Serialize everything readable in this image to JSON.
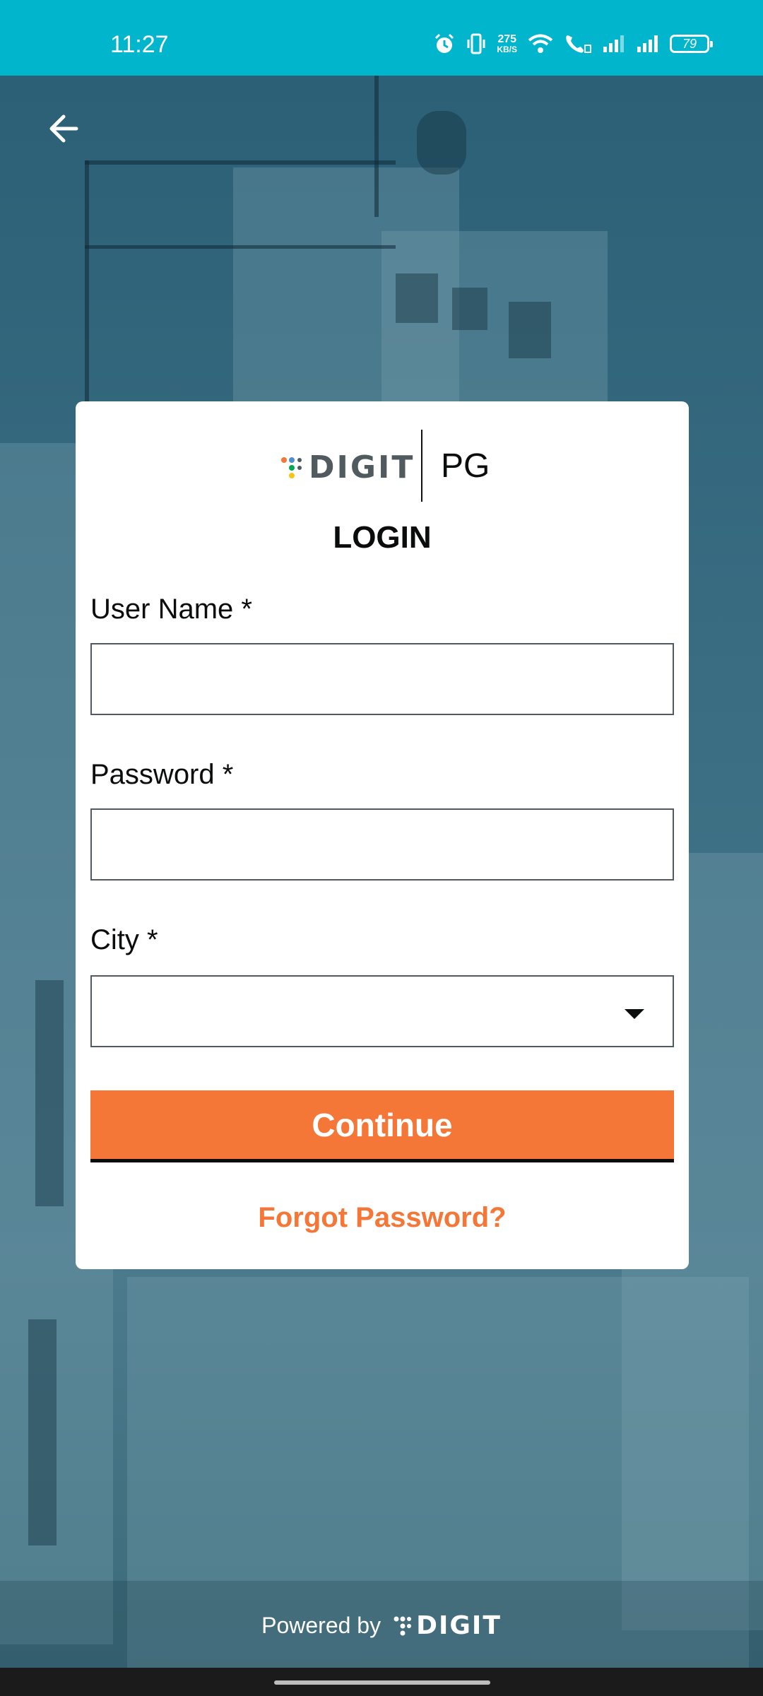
{
  "status_bar": {
    "time": "11:27",
    "net_speed_value": "275",
    "net_speed_unit": "KB/S",
    "battery": "79",
    "icons": [
      "alarm-icon",
      "vibrate-icon",
      "wifi-icon",
      "wifi-call-icon",
      "signal-icon",
      "signal-icon"
    ]
  },
  "header": {
    "back_icon": "arrow-left-icon"
  },
  "login_card": {
    "brand_name": "DIGIT",
    "module": "PG",
    "title": "LOGIN",
    "fields": {
      "username": {
        "label": "User Name *",
        "value": "",
        "placeholder": ""
      },
      "password": {
        "label": "Password *",
        "value": "",
        "placeholder": ""
      },
      "city": {
        "label": "City *",
        "value": ""
      }
    },
    "continue_label": "Continue",
    "forgot_label": "Forgot Password?"
  },
  "footer": {
    "powered_by": "Powered by",
    "brand": "DIGIT"
  },
  "colors": {
    "status_bar": "#00b5cc",
    "accent": "#f47738",
    "card": "#ffffff",
    "text": "#0b0c0c"
  }
}
